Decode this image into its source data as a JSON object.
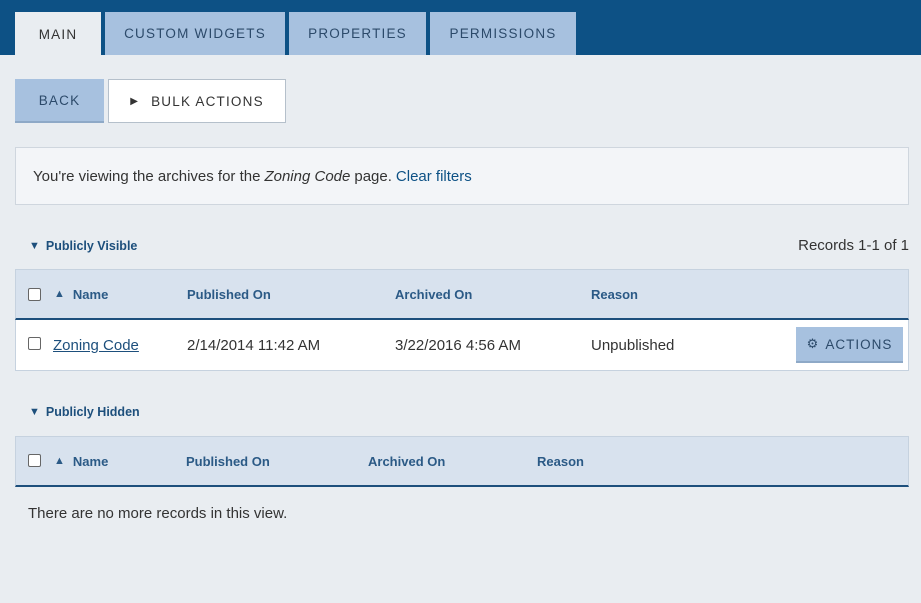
{
  "tabs": [
    {
      "label": "MAIN",
      "active": true
    },
    {
      "label": "CUSTOM WIDGETS",
      "active": false
    },
    {
      "label": "PROPERTIES",
      "active": false
    },
    {
      "label": "PERMISSIONS",
      "active": false
    }
  ],
  "toolbar": {
    "back_label": "BACK",
    "bulk_label": "BULK ACTIONS",
    "bulk_icon": "play-triangle-icon"
  },
  "info": {
    "prefix": "You're viewing the archives for the",
    "page_name": "Zoning Code",
    "suffix": "page.",
    "clear_link": "Clear filters"
  },
  "visible_section": {
    "title": "Publicly Visible",
    "records_text": "Records 1-1 of 1",
    "columns": [
      "Name",
      "Published On",
      "Archived On",
      "Reason"
    ],
    "rows": [
      {
        "name": "Zoning Code",
        "published_on": "2/14/2014 11:42 AM",
        "archived_on": "3/22/2016 4:56 AM",
        "reason": "Unpublished",
        "actions_label": "ACTIONS"
      }
    ]
  },
  "hidden_section": {
    "title": "Publicly Hidden",
    "columns": [
      "Name",
      "Published On",
      "Archived On",
      "Reason"
    ],
    "empty_text": "There are no more records in this view."
  },
  "colors": {
    "header_bg": "#0d5185",
    "tab_bg": "#a7c1df",
    "page_bg": "#e9edf1",
    "link": "#1d4f7c"
  }
}
